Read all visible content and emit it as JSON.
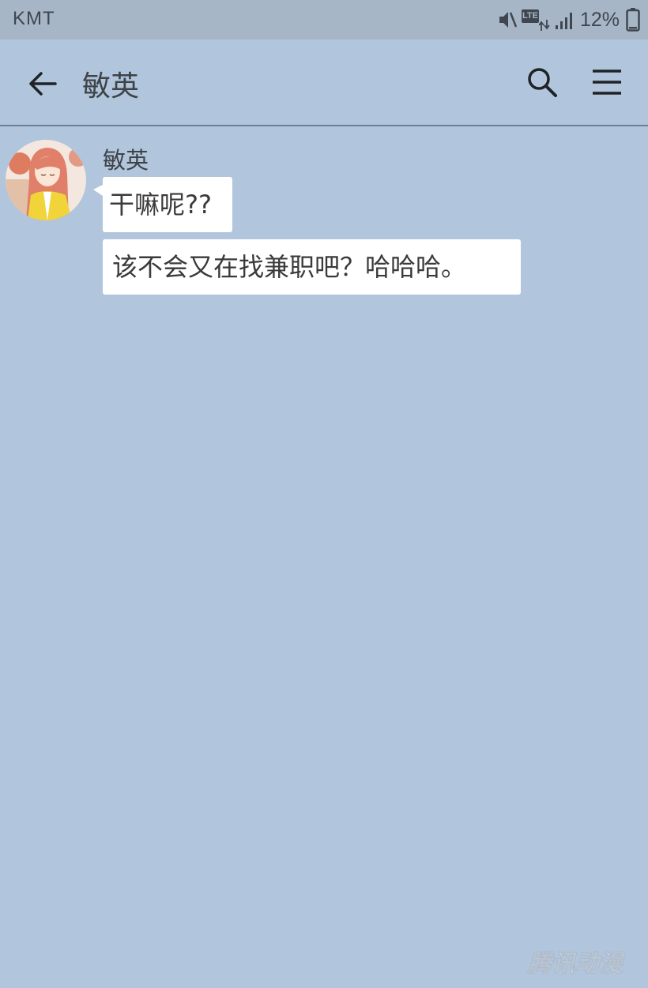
{
  "status_bar": {
    "carrier": "KMT",
    "network_label": "LTE",
    "battery_percent": "12%",
    "icons": [
      "mute-icon",
      "lte-icon",
      "signal-icon",
      "battery-icon"
    ]
  },
  "app_bar": {
    "title": "敏英",
    "icons": [
      "back-arrow-icon",
      "search-icon",
      "menu-icon"
    ]
  },
  "conversation": {
    "sender_name": "敏英",
    "messages": [
      {
        "text": "干嘛呢??"
      },
      {
        "text": "该不会又在找兼职吧？哈哈哈。"
      }
    ]
  },
  "watermark": {
    "text": "腾讯动漫"
  },
  "colors": {
    "background": "#b1c6dc",
    "status_bar": "#a7b6c6",
    "bubble": "#ffffff",
    "text": "#3a3a3a"
  }
}
